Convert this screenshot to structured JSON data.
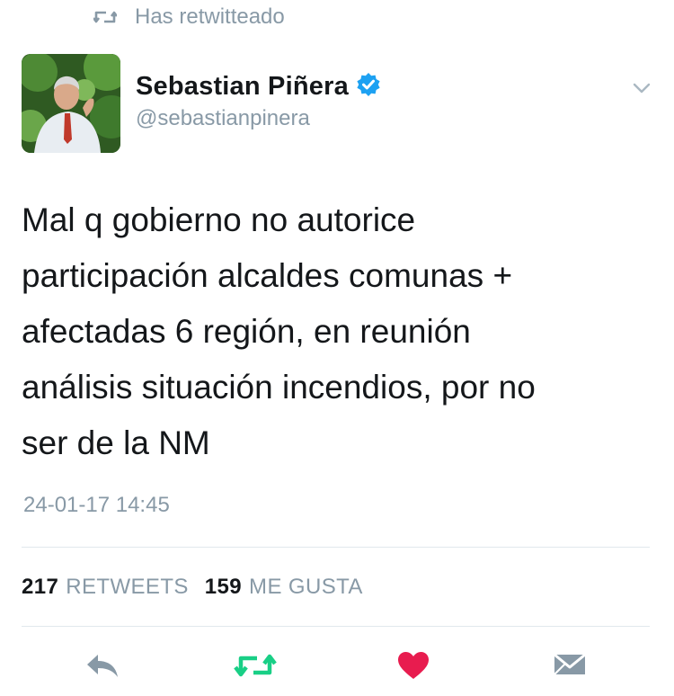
{
  "context": {
    "retweet_label": "Has retwitteado"
  },
  "author": {
    "display_name": "Sebastian Piñera",
    "handle": "@sebastianpinera",
    "verified": true
  },
  "tweet": {
    "text": "Mal q gobierno no autorice\nparticipación alcaldes comunas +\nafectadas 6 región, en reunión\nanálisis situación incendios, por no\nser de la NM",
    "timestamp": "24-01-17 14:45"
  },
  "stats": {
    "retweets_count": "217",
    "retweets_label": "RETWEETS",
    "likes_count": "159",
    "likes_label": "ME GUSTA"
  },
  "actions": {
    "reply": "reply-icon",
    "retweet": "retweet-icon",
    "like": "heart-icon",
    "message": "direct-message-icon"
  },
  "colors": {
    "secondary_text": "#8899a6",
    "primary_text": "#14171a",
    "retweet_active": "#19cf86",
    "like_active": "#e81c4f",
    "verified_badge": "#1da1f2",
    "divider": "#e1e8ed"
  }
}
